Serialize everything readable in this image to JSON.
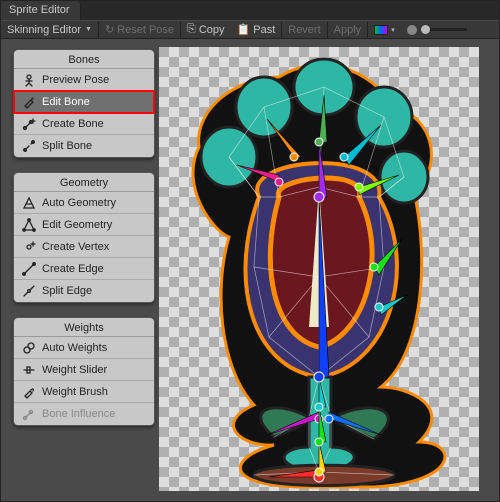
{
  "window": {
    "title": "Sprite Editor"
  },
  "toolbar": {
    "mode": "Skinning Editor",
    "reset_pose": "Reset Pose",
    "copy": "Copy",
    "paste": "Past",
    "revert": "Revert",
    "apply": "Apply"
  },
  "panels": {
    "bones": {
      "title": "Bones",
      "items": [
        {
          "label": "Preview Pose",
          "icon": "preview-pose-icon",
          "selected": false
        },
        {
          "label": "Edit Bone",
          "icon": "edit-bone-icon",
          "selected": true
        },
        {
          "label": "Create Bone",
          "icon": "create-bone-icon",
          "selected": false
        },
        {
          "label": "Split Bone",
          "icon": "split-bone-icon",
          "selected": false
        }
      ]
    },
    "geometry": {
      "title": "Geometry",
      "items": [
        {
          "label": "Auto Geometry",
          "icon": "auto-geometry-icon"
        },
        {
          "label": "Edit Geometry",
          "icon": "edit-geometry-icon"
        },
        {
          "label": "Create Vertex",
          "icon": "create-vertex-icon"
        },
        {
          "label": "Create Edge",
          "icon": "create-edge-icon"
        },
        {
          "label": "Split Edge",
          "icon": "split-edge-icon"
        }
      ]
    },
    "weights": {
      "title": "Weights",
      "items": [
        {
          "label": "Auto Weights",
          "icon": "auto-weights-icon",
          "dim": false
        },
        {
          "label": "Weight Slider",
          "icon": "weight-slider-icon",
          "dim": false
        },
        {
          "label": "Weight Brush",
          "icon": "weight-brush-icon",
          "dim": false
        },
        {
          "label": "Bone Influence",
          "icon": "bone-influence-icon",
          "dim": true
        }
      ]
    }
  },
  "bone_colors": {
    "root": "#ff2a2a",
    "stem_low": "#ffd400",
    "stem_mid": "#16e016",
    "stem_high": "#18c8c8",
    "trunk": "#1040ff",
    "head_center": "#a32af0",
    "toe1": "#e81e8e",
    "toe2": "#ff8c00",
    "toe3": "#4caf50",
    "toe4": "#00bcd4",
    "toe5": "#7cff00",
    "leaf_l": "#c816c8",
    "leaf_r": "#0d6efd",
    "arm_r": "#16e016",
    "arm_r2": "#18c8c8"
  }
}
